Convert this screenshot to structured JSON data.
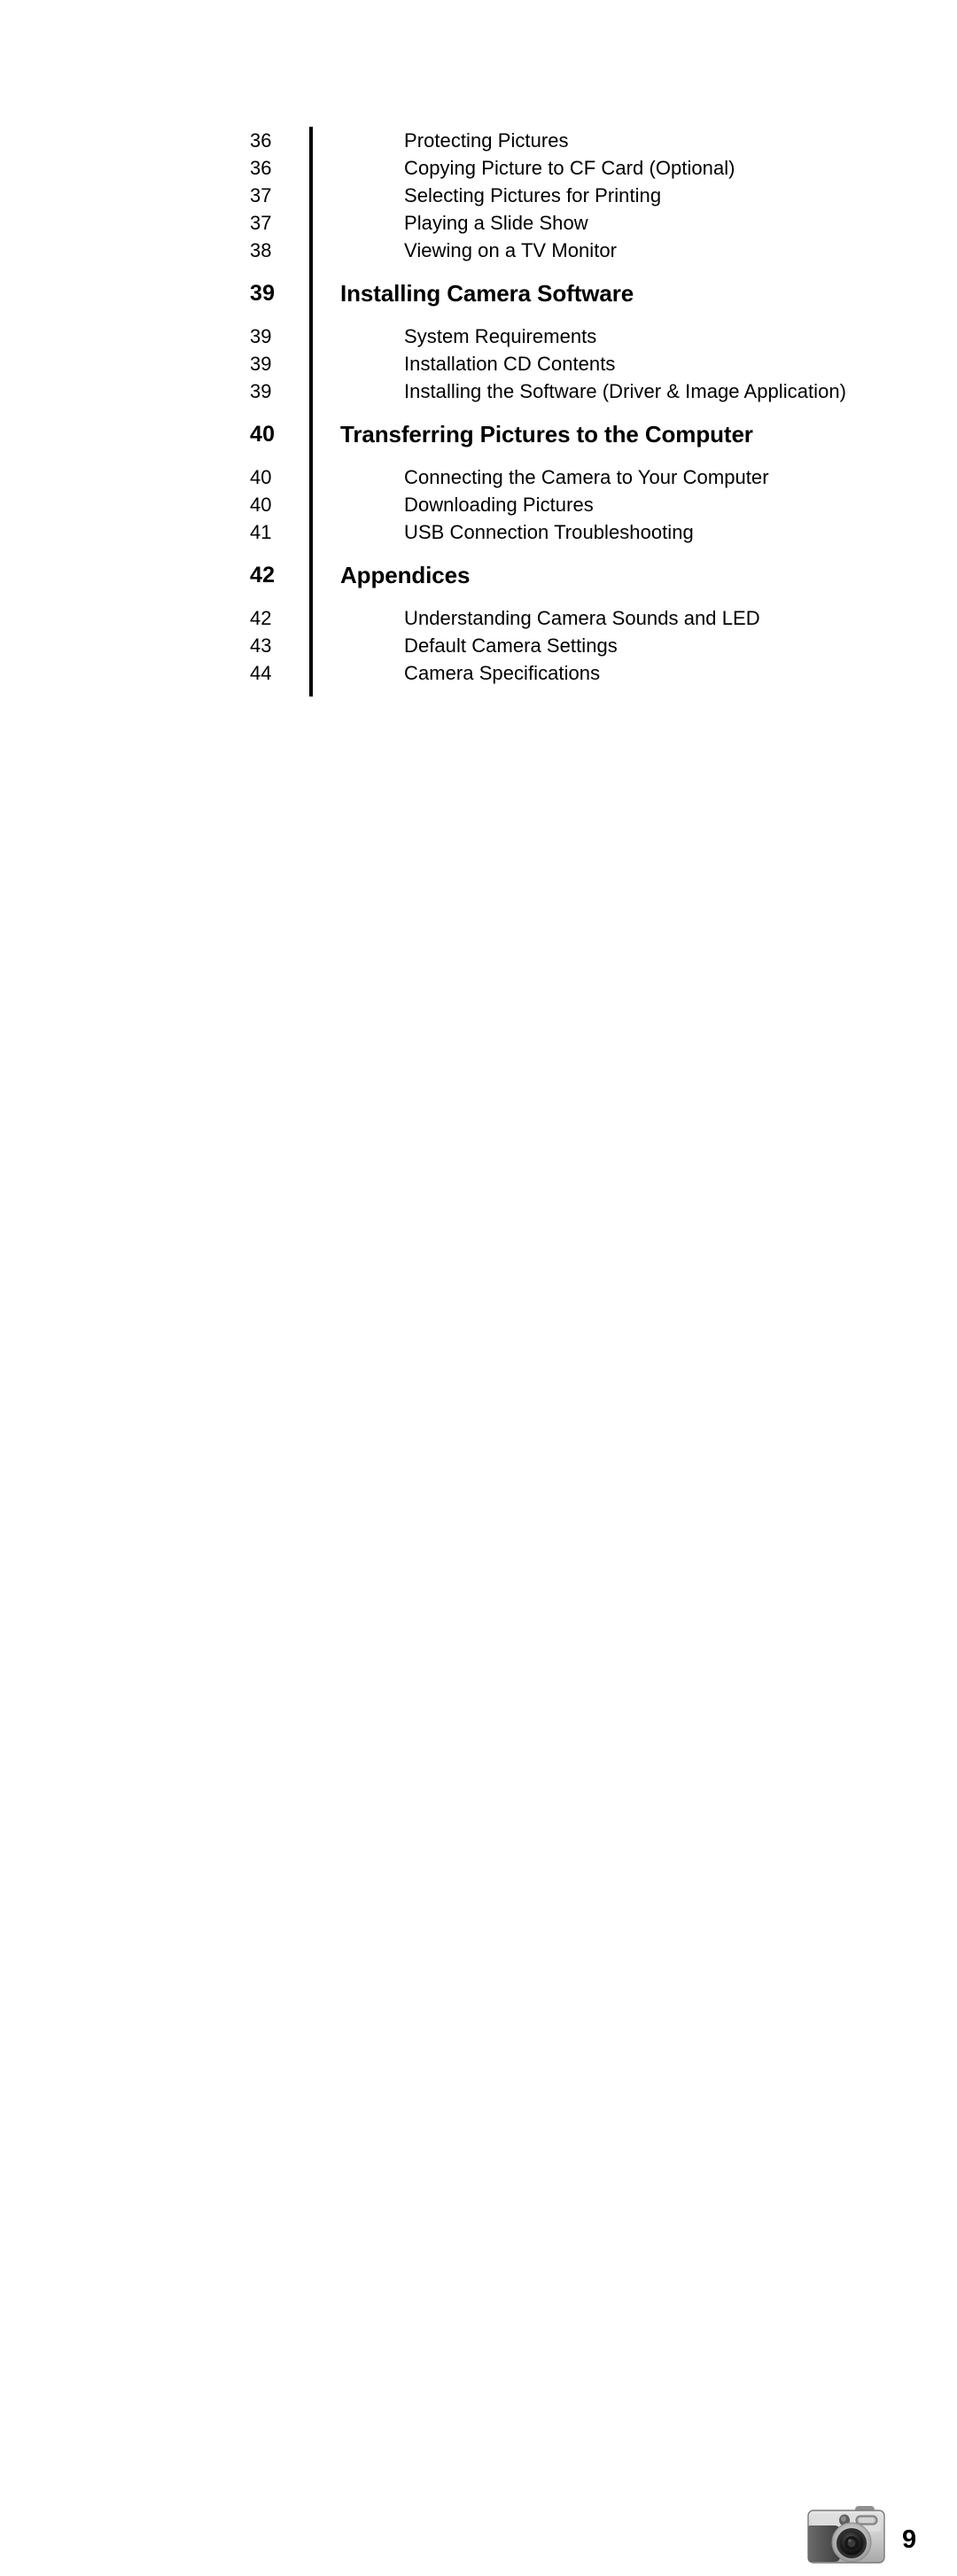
{
  "document": {
    "type": "table-of-contents",
    "page_number": "9"
  },
  "toc": {
    "rows": [
      {
        "kind": "entry",
        "page": "36",
        "title": "Protecting Pictures"
      },
      {
        "kind": "entry",
        "page": "36",
        "title": "Copying Picture to CF Card (Optional)"
      },
      {
        "kind": "entry",
        "page": "37",
        "title": "Selecting Pictures for Printing"
      },
      {
        "kind": "entry",
        "page": "37",
        "title": "Playing a Slide Show"
      },
      {
        "kind": "entry",
        "page": "38",
        "title": "Viewing on a TV Monitor"
      },
      {
        "kind": "section",
        "page": "39",
        "title": "Installing Camera Software"
      },
      {
        "kind": "entry",
        "page": "39",
        "title": "System Requirements"
      },
      {
        "kind": "entry",
        "page": "39",
        "title": "Installation CD Contents"
      },
      {
        "kind": "entry",
        "page": "39",
        "title": "Installing the Software (Driver & Image Application)"
      },
      {
        "kind": "section",
        "page": "40",
        "title": "Transferring Pictures to the Computer"
      },
      {
        "kind": "entry",
        "page": "40",
        "title": "Connecting the Camera to Your Computer"
      },
      {
        "kind": "entry",
        "page": "40",
        "title": "Downloading Pictures"
      },
      {
        "kind": "entry",
        "page": "41",
        "title": "USB Connection Troubleshooting"
      },
      {
        "kind": "section",
        "page": "42",
        "title": "Appendices"
      },
      {
        "kind": "entry",
        "page": "42",
        "title": "Understanding Camera Sounds and LED"
      },
      {
        "kind": "entry",
        "page": "43",
        "title": "Default Camera Settings"
      },
      {
        "kind": "entry",
        "page": "44",
        "title": "Camera Specifications"
      }
    ]
  },
  "footer": {
    "camera_icon_name": "digital-camera-icon",
    "page_number": "9"
  },
  "colors": {
    "text": "#000000",
    "rule": "#000000",
    "background": "#ffffff",
    "camera_body_light": "#d9d9d9",
    "camera_body_mid": "#b8b8b8",
    "camera_grip_dark": "#4a4a4a",
    "camera_lens_dark": "#1a1a1a"
  }
}
